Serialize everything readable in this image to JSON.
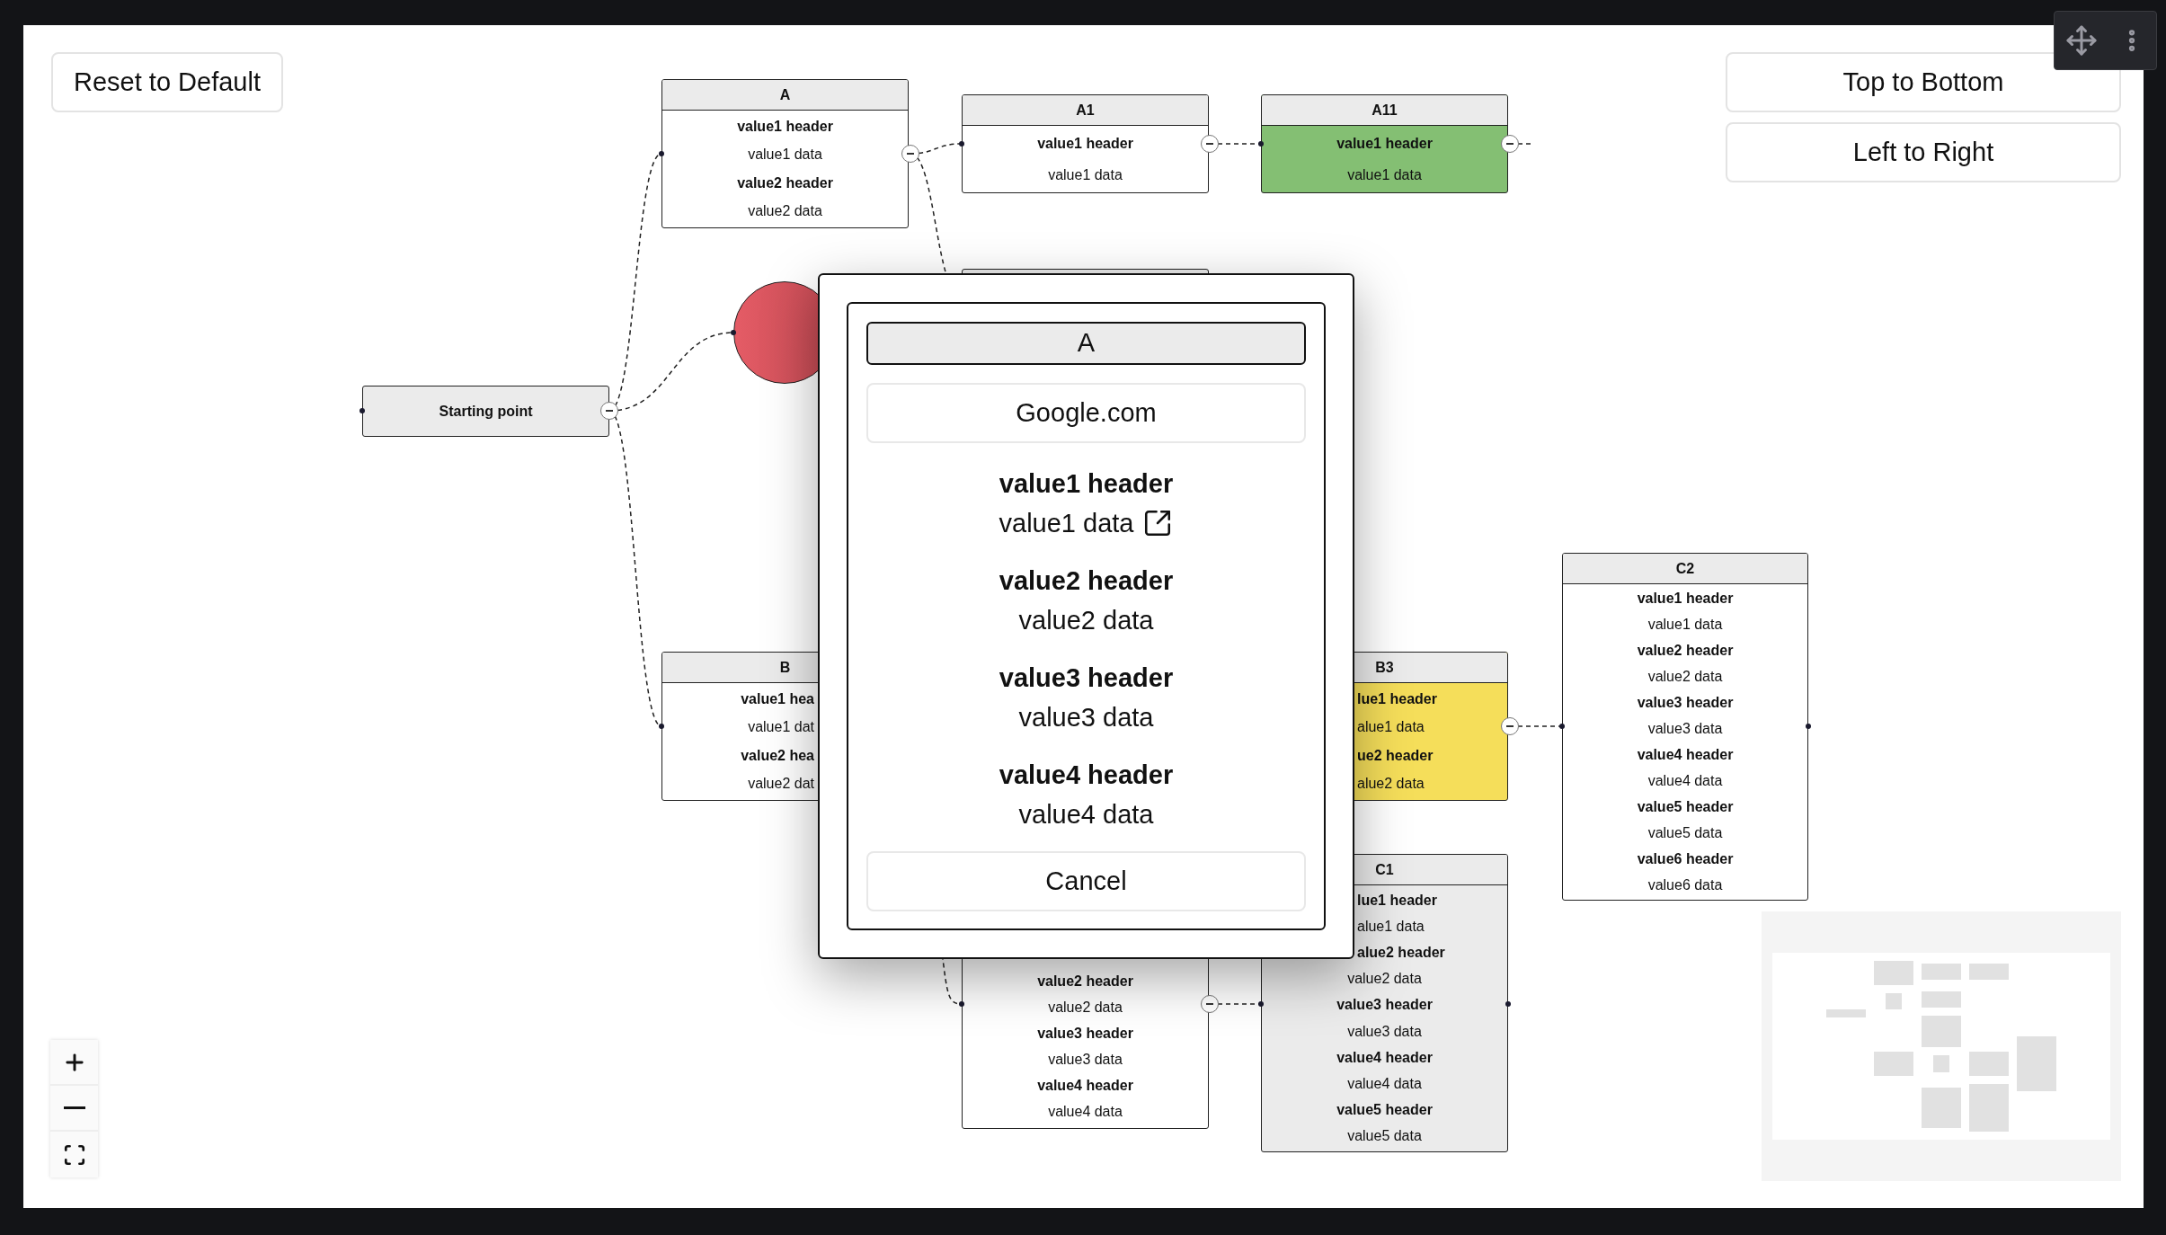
{
  "buttons": {
    "reset": "Reset to Default",
    "layout": [
      "Top to Bottom",
      "Left to Right"
    ]
  },
  "start_node": {
    "label": "Starting point"
  },
  "nodes": [
    {
      "title": "A",
      "color": "#ffffff",
      "rows": [
        {
          "text": "value1 header",
          "kind": "header"
        },
        {
          "text": "value1 data",
          "kind": "data"
        },
        {
          "text": "value2 header",
          "kind": "header"
        },
        {
          "text": "value2 data",
          "kind": "data"
        }
      ]
    },
    {
      "title": "A1",
      "color": "#ffffff",
      "rows": [
        {
          "text": "value1 header",
          "kind": "header"
        },
        {
          "text": "value1 data",
          "kind": "data"
        }
      ]
    },
    {
      "title": "A11",
      "color": "#84bf73",
      "rows": [
        {
          "text": "value1 header",
          "kind": "header"
        },
        {
          "text": "value1 data",
          "kind": "data"
        }
      ]
    },
    {
      "title": "B",
      "color": "#ffffff",
      "rows": [
        {
          "text": "value1 hea",
          "kind": "header"
        },
        {
          "text": "value1 dat",
          "kind": "data"
        },
        {
          "text": "value2 hea",
          "kind": "header"
        },
        {
          "text": "value2 dat",
          "kind": "data"
        }
      ]
    },
    {
      "title": "B3",
      "color": "#f5de5a",
      "rows": [
        {
          "text": "lue1 header",
          "kind": "header"
        },
        {
          "text": "alue1 data",
          "kind": "data"
        },
        {
          "text": "ue2 header",
          "kind": "header"
        },
        {
          "text": "alue2 data",
          "kind": "data"
        }
      ]
    },
    {
      "title": "C2",
      "color": "#ffffff",
      "rows": [
        {
          "text": "value1 header",
          "kind": "header"
        },
        {
          "text": "value1 data",
          "kind": "data"
        },
        {
          "text": "value2 header",
          "kind": "header"
        },
        {
          "text": "value2 data",
          "kind": "data"
        },
        {
          "text": "value3 header",
          "kind": "header"
        },
        {
          "text": "value3 data",
          "kind": "data"
        },
        {
          "text": "value4 header",
          "kind": "header"
        },
        {
          "text": "value4 data",
          "kind": "data"
        },
        {
          "text": "value5 header",
          "kind": "header"
        },
        {
          "text": "value5 data",
          "kind": "data"
        },
        {
          "text": "value6 header",
          "kind": "header"
        },
        {
          "text": "value6 data",
          "kind": "data"
        }
      ]
    },
    {
      "title": "C1",
      "color": "#ebebeb",
      "rows": [
        {
          "text": "lue1 header",
          "kind": "header"
        },
        {
          "text": "alue1 data",
          "kind": "data"
        },
        {
          "text": "alue2 header",
          "kind": "header"
        },
        {
          "text": "value2 data",
          "kind": "data"
        },
        {
          "text": "value3 header",
          "kind": "header"
        },
        {
          "text": "value3 data",
          "kind": "data"
        },
        {
          "text": "value4 header",
          "kind": "header"
        },
        {
          "text": "value4 data",
          "kind": "data"
        },
        {
          "text": "value5 header",
          "kind": "header"
        },
        {
          "text": "value5 data",
          "kind": "data"
        }
      ]
    },
    {
      "color": "#ffffff",
      "rows": [
        {
          "text": "value2 header",
          "kind": "header"
        },
        {
          "text": "value2 data",
          "kind": "data"
        },
        {
          "text": "value3 header",
          "kind": "header"
        },
        {
          "text": "value3 data",
          "kind": "data"
        },
        {
          "text": "value4 header",
          "kind": "header"
        },
        {
          "text": "value4 data",
          "kind": "data"
        }
      ]
    }
  ],
  "modal": {
    "title": "A",
    "link": "Google.com",
    "fields": [
      {
        "header": "value1 header",
        "data": "value1 data",
        "external_link": true
      },
      {
        "header": "value2 header",
        "data": "value2 data",
        "external_link": false
      },
      {
        "header": "value3 header",
        "data": "value3 data",
        "external_link": false
      },
      {
        "header": "value4 header",
        "data": "value4 data",
        "external_link": false
      }
    ],
    "cancel": "Cancel"
  }
}
